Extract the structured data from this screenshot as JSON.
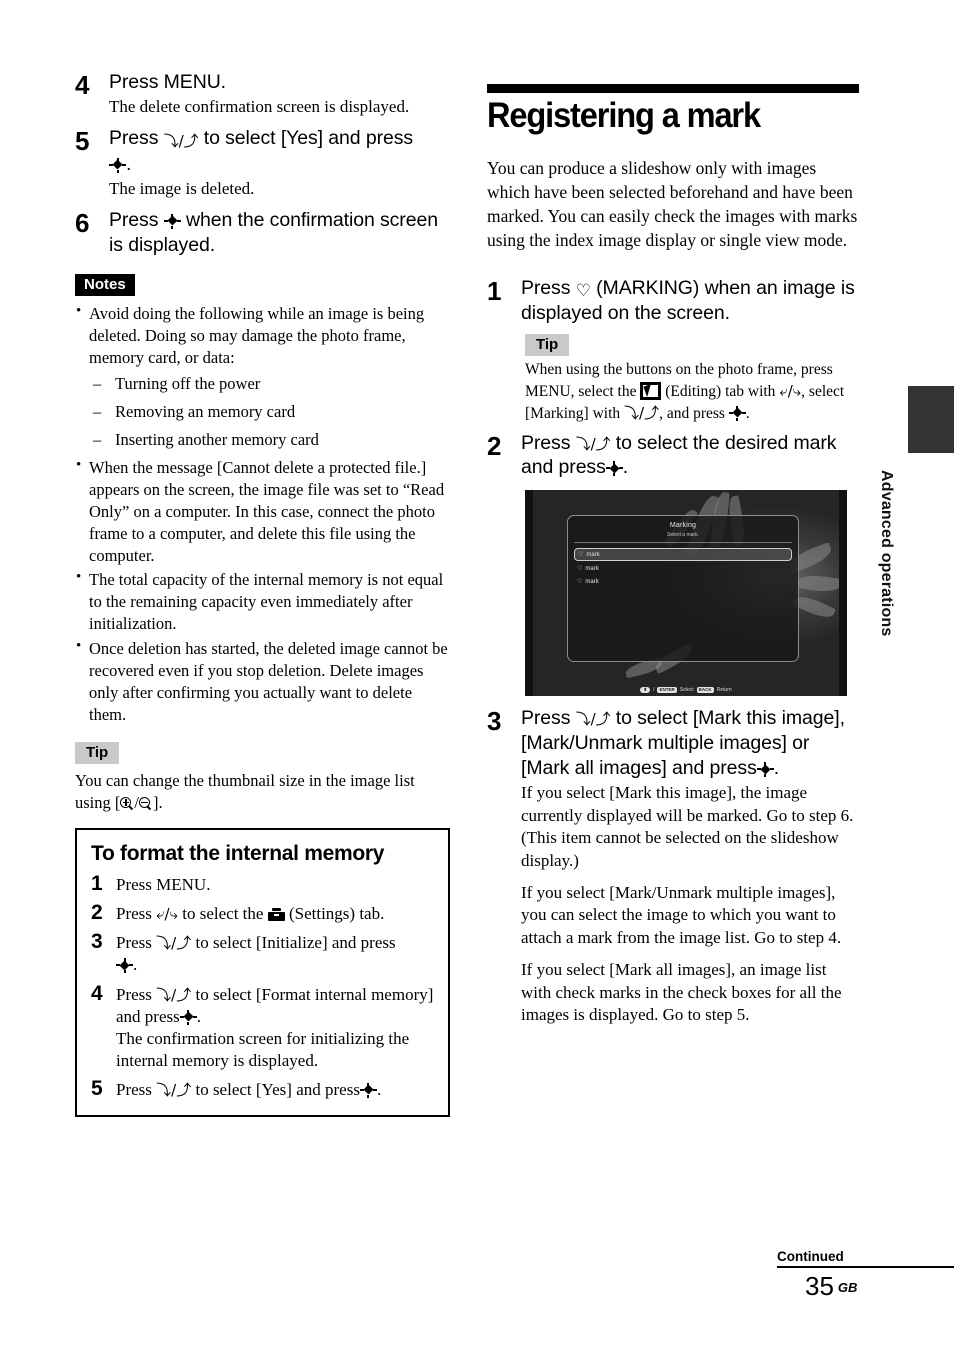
{
  "left_column": {
    "steps": [
      {
        "num": "4",
        "head": "Press MENU.",
        "sub": "The delete confirmation screen is displayed."
      },
      {
        "num": "5",
        "head_a": "Press",
        "head_b": "to select [Yes] and press",
        "head_c": ".",
        "sub": "The image is deleted."
      },
      {
        "num": "6",
        "head_a": "Press",
        "head_b": "when the confirmation screen is displayed."
      }
    ],
    "notes_label": "Notes",
    "notes": [
      {
        "text": "Avoid doing the following while an image is being deleted. Doing so may damage the photo frame, memory card, or data:",
        "sub_items": [
          "Turning off the power",
          "Removing an memory card",
          "Inserting another memory card"
        ]
      },
      {
        "text": "When the message [Cannot delete a protected file.] appears on the screen, the image file was set to “Read Only” on a computer. In this case, connect the photo frame to a computer, and delete this file using the computer."
      },
      {
        "text": "The total capacity of the internal memory is not equal to the remaining capacity even immediately after initialization."
      },
      {
        "text": "Once deletion has started, the deleted image cannot be recovered even if you stop deletion. Delete images only after confirming you actually want to delete them."
      }
    ],
    "tip_label": "Tip",
    "tip_text_a": "You can change the thumbnail size in the image list using [",
    "tip_text_b": "/",
    "tip_text_c": "].",
    "boxed": {
      "title": "To format the internal memory",
      "steps": [
        {
          "num": "1",
          "text": "Press MENU."
        },
        {
          "num": "2",
          "text_a": "Press",
          "text_b": "to select the",
          "text_c": "(Settings) tab."
        },
        {
          "num": "3",
          "text_a": "Press",
          "text_b": "to select [Initialize] and press",
          "text_c": "."
        },
        {
          "num": "4",
          "text_a": "Press",
          "text_b": "to select [Format internal memory] and press",
          "text_c": ".",
          "sub": "The confirmation screen for initializing the internal memory is displayed."
        },
        {
          "num": "5",
          "text_a": "Press",
          "text_b": "to select [Yes] and press",
          "text_c": "."
        }
      ]
    }
  },
  "right_column": {
    "heading": "Registering a mark",
    "intro": "You can produce a slideshow only with images which have been selected beforehand and have been marked. You can easily check the images with marks using the index image display or single view mode.",
    "step1": {
      "num": "1",
      "text_a": "Press",
      "text_b": "(MARKING) when an image is displayed on the screen."
    },
    "tip_label": "Tip",
    "tip_text_a": "When using the buttons on the photo frame, press MENU, select the",
    "tip_text_b": "(Editing) tab with",
    "tip_text_c": ", select [Marking] with",
    "tip_text_d": ", and press",
    "tip_text_e": ".",
    "step2": {
      "num": "2",
      "text_a": "Press",
      "text_b": "to select the desired mark and press",
      "text_c": "."
    },
    "screen": {
      "dialog_title": "Marking",
      "dialog_subtitle": "Select a mark.",
      "items": [
        {
          "label": "mark",
          "selected": true
        },
        {
          "label": "mark",
          "selected": false
        },
        {
          "label": "mark",
          "selected": false
        }
      ],
      "bottom_bar": {
        "dpad_key": "⬍",
        "separator": "/",
        "enter_key": "ENTER",
        "enter_label": "Select",
        "back_key": "BACK",
        "back_label": "Return"
      }
    },
    "step3": {
      "num": "3",
      "text_a": "Press",
      "text_b": "to select [Mark this image], [Mark/Unmark multiple images] or [Mark all images] and press",
      "text_c": ".",
      "paras": [
        "If you select [Mark this image], the image currently displayed will be marked. Go to step 6. (This item cannot be selected on the slideshow display.)",
        "If you select [Mark/Unmark multiple images], you can select the image to which you want to attach a mark from the image list. Go to step 4.",
        "If you select [Mark all images], an image list with check marks in the check boxes for all the images is displayed. Go to step 5."
      ]
    }
  },
  "side_tab": {
    "label": "Advanced operations"
  },
  "footer": {
    "continued": "Continued",
    "page_number": "35",
    "region": "GB"
  },
  "icons": {
    "updown": "⬍",
    "leftright": "⬌",
    "heart": "♡",
    "enter_dpad": "enter-dpad-icon"
  },
  "colors": {
    "notes_bg": "#000000",
    "tip_bg": "#c9c9c9",
    "side_tab": "#333333"
  }
}
